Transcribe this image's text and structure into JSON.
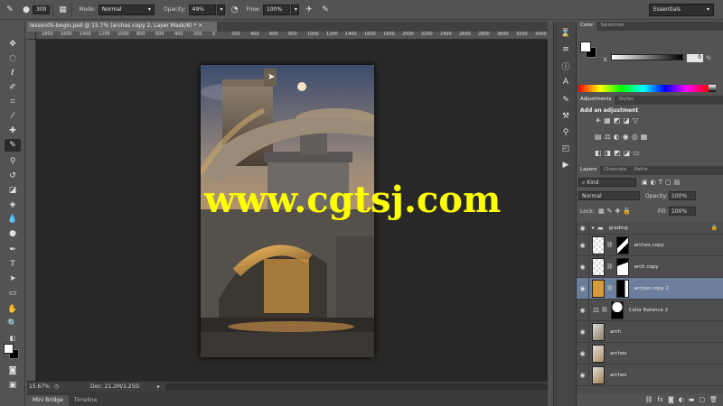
{
  "options_bar": {
    "brush_size": "300",
    "mode_label": "Mode:",
    "mode_value": "Normal",
    "opacity_label": "Opacity:",
    "opacity_value": "49%",
    "flow_label": "Flow:",
    "flow_value": "100%",
    "workspace": "Essentials"
  },
  "document": {
    "tab_title": "lesson05-begin.psd @ 15.7% (arches copy 2, Layer Mask/8) *",
    "ruler_ticks": [
      "1800",
      "1600",
      "1400",
      "1200",
      "1000",
      "800",
      "600",
      "400",
      "200",
      "0",
      "200",
      "400",
      "600",
      "800",
      "1000",
      "1200",
      "1400",
      "1600",
      "1800",
      "2000",
      "2200",
      "2400",
      "2600",
      "2800",
      "3000",
      "3200",
      "3400"
    ],
    "zoom": "15.67%",
    "doc_info": "Doc: 21.2M/1.25G"
  },
  "watermark": "www.cgtsj.com",
  "bottom_tabs": [
    "Mini Bridge",
    "Timeline"
  ],
  "color_panel": {
    "tabs": [
      "Color",
      "Swatches"
    ],
    "k_label": "K",
    "k_value": "0",
    "k_unit": "%"
  },
  "adjustments_panel": {
    "tabs": [
      "Adjustments",
      "Styles"
    ],
    "heading": "Add an adjustment"
  },
  "layers_panel": {
    "tabs": [
      "Layers",
      "Channels",
      "Paths"
    ],
    "filter_kind": "Kind",
    "blend_mode": "Normal",
    "opacity_label": "Opacity:",
    "opacity_value": "100%",
    "lock_label": "Lock:",
    "fill_label": "Fill:",
    "fill_value": "100%",
    "layers": [
      {
        "name": "grading",
        "type": "group"
      },
      {
        "name": "arches copy",
        "type": "masked"
      },
      {
        "name": "arch copy",
        "type": "masked"
      },
      {
        "name": "arches copy 2",
        "type": "masked",
        "selected": true
      },
      {
        "name": "Color Balance 2",
        "type": "adjustment"
      },
      {
        "name": "arch",
        "type": "pixel"
      },
      {
        "name": "arches",
        "type": "pixel"
      },
      {
        "name": "arches",
        "type": "pixel"
      }
    ]
  },
  "colors": {
    "selection": "#6b7e9b",
    "watermark": "#ffff00"
  }
}
